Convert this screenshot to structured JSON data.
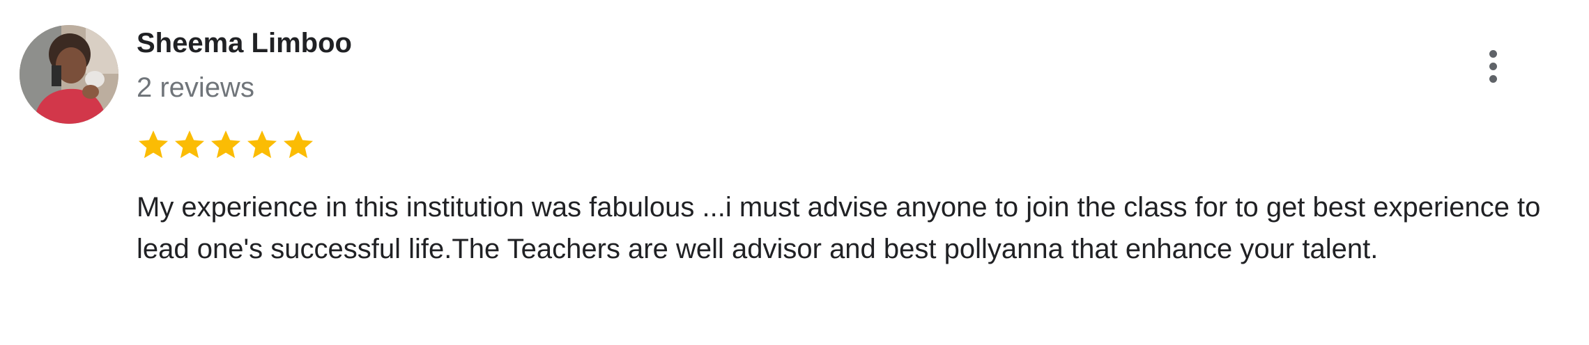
{
  "review": {
    "reviewer_name": "Sheema Limboo",
    "review_count": "2 reviews",
    "rating": 5,
    "rating_max": 5,
    "star_color": "#fbbc04",
    "text": "My experience in this institution was fabulous ...i must advise anyone to join the class for to get best experience to lead one's successful life.The Teachers are well advisor and best pollyanna that enhance your talent.",
    "more_icon": "more-vertical-icon",
    "star_icon": "star-icon"
  }
}
